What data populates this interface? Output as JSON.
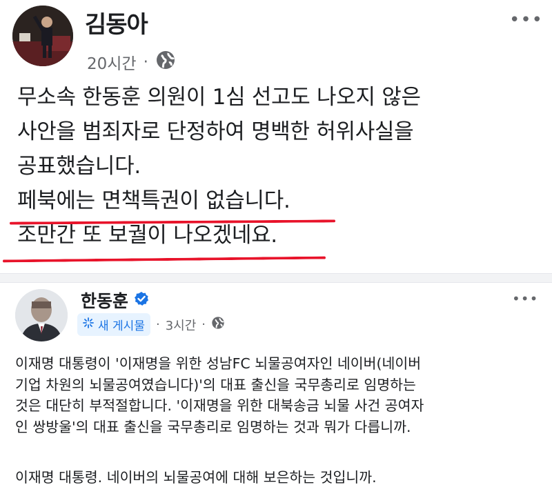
{
  "post1": {
    "author": "김동아",
    "time": "20시간",
    "separator": "·",
    "more": "•••",
    "lines": [
      "무소속 한동훈 의원이 1심 선고도 나오지 않은",
      "사안을 범죄자로 단정하여 명백한 허위사실을",
      "공표했습니다.",
      "페북에는 면책특권이 없습니다.",
      "조만간 또 보궐이 나오겠네요."
    ],
    "underline_color": "#e8132a"
  },
  "post2": {
    "author": "한동훈",
    "verified_icon": "verified-badge-icon",
    "new_tag": "새 게시물",
    "time": "3시간",
    "separator": "·",
    "more": "•••",
    "paragraph1": [
      "이재명 대통령이 '이재명을 위한 성남FC 뇌물공여자인 네이버(네이버",
      "기업 차원의 뇌물공여였습니다)'의 대표 출신을 국무총리로 임명하는",
      "것은 대단히 부적절합니다. '이재명을 위한 대북송금 뇌물 사건 공여자",
      "인 쌍방울'의 대표 출신을 국무총리로 임명하는 것과 뭐가 다릅니까."
    ],
    "paragraph2": [
      "이재명 대통령. 네이버의 뇌물공여에 대해 보은하는 것입니까."
    ]
  },
  "colors": {
    "accent_blue": "#1b74e4",
    "meta_gray": "#65676b",
    "text": "#1c1e21"
  }
}
